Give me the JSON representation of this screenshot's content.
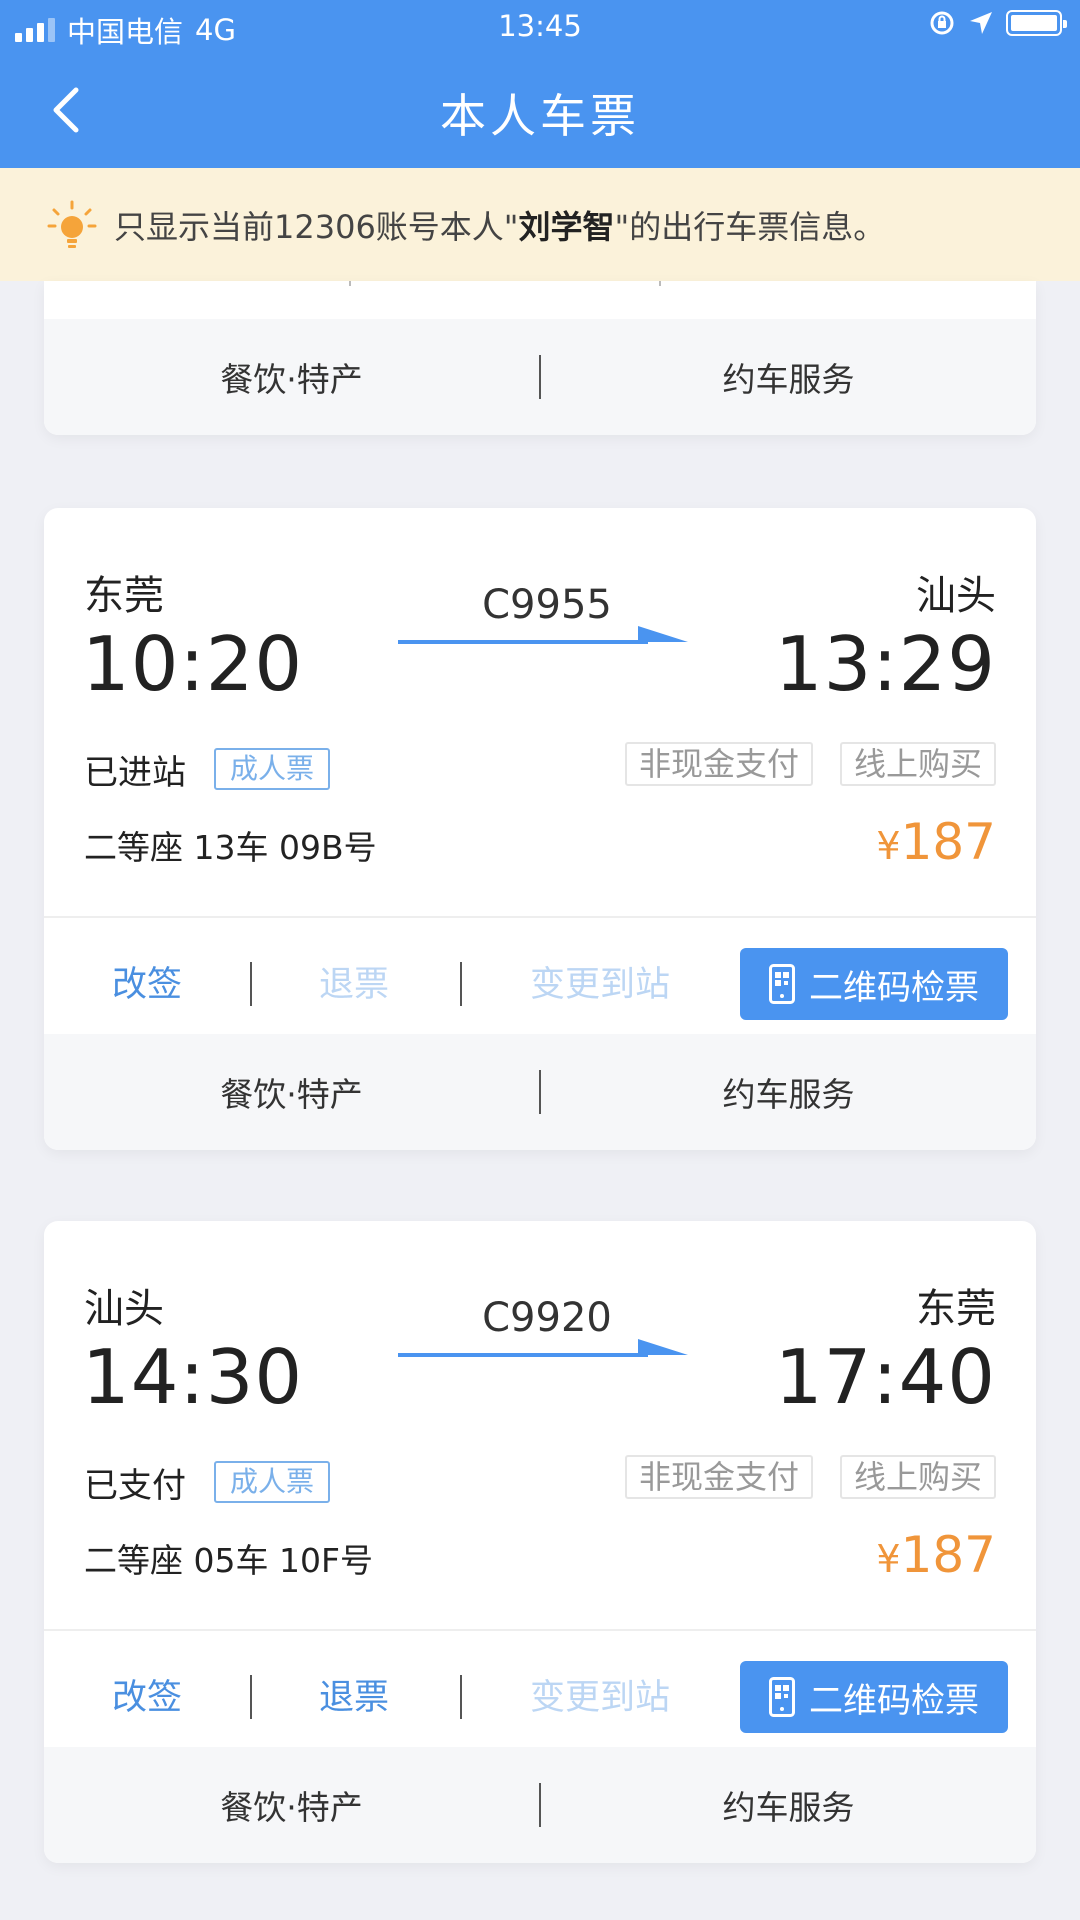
{
  "status_bar": {
    "carrier": "中国电信",
    "network": "4G",
    "time": "13:45"
  },
  "nav": {
    "title": "本人车票"
  },
  "notice": {
    "prefix": "只显示当前12306账号本人\"",
    "name": "刘学智",
    "suffix": "\"的出行车票信息。"
  },
  "services": {
    "food": "餐饮·特产",
    "car": "约车服务"
  },
  "tickets": [
    {
      "from_station": "东莞",
      "to_station": "汕头",
      "train_no": "C9955",
      "depart_time": "10:20",
      "arrive_time": "13:29",
      "status": "已进站",
      "ticket_type": "成人票",
      "payment_tag": "非现金支付",
      "channel_tag": "线上购买",
      "seat": "二等座 13车 09B号",
      "currency": "¥",
      "price": "187",
      "actions": {
        "change": "改签",
        "refund": "退票",
        "change_station": "变更到站",
        "qr_check": "二维码检票"
      },
      "refund_enabled": false
    },
    {
      "from_station": "汕头",
      "to_station": "东莞",
      "train_no": "C9920",
      "depart_time": "14:30",
      "arrive_time": "17:40",
      "status": "已支付",
      "ticket_type": "成人票",
      "payment_tag": "非现金支付",
      "channel_tag": "线上购买",
      "seat": "二等座 05车 10F号",
      "currency": "¥",
      "price": "187",
      "actions": {
        "change": "改签",
        "refund": "退票",
        "change_station": "变更到站",
        "qr_check": "二维码检票"
      },
      "refund_enabled": true
    }
  ],
  "colors": {
    "primary": "#4a94f0",
    "notice_bg": "#fbf2da",
    "price": "#f0953a",
    "disabled_link": "#bcd6f4"
  }
}
